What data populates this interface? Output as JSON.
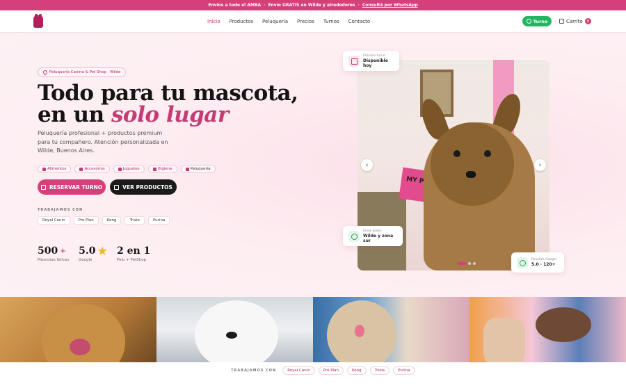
{
  "topbar": {
    "item1": "Envíos a todo el AMBA",
    "item2": "Envío GRATIS en Wilde y alrededores",
    "sep": "·",
    "link": "Consultá por WhatsApp"
  },
  "header": {
    "nav": [
      "Inicio",
      "Productos",
      "Peluquería",
      "Precios",
      "Turnos",
      "Contacto"
    ],
    "turno_label": "Turno",
    "cart_label": "Carrito",
    "cart_count": "0"
  },
  "hero": {
    "tag": "Peluquería Canina & Pet Shop · Wilde",
    "title_line1": "Todo para tu mascota,",
    "title_line2_plain": "en un ",
    "title_line2_accent": "solo lugar",
    "description": "Peluquería profesional + productos premium para tu compañero. Atención personalizada en Wilde, Buenos Aires.",
    "chips": [
      "Alimentos",
      "Accesorios",
      "Juguetes",
      "Higiene",
      "Peluquería"
    ],
    "btn_primary": "RESERVAR TURNO",
    "btn_secondary": "VER PRODUCTOS",
    "brands_label": "TRABAJAMOS CON",
    "brands": [
      "Royal Canin",
      "Pro Plan",
      "Kong",
      "Trixie",
      "Purina"
    ],
    "stats": [
      {
        "value": "500",
        "suffix": "+",
        "label": "Mascotas felices"
      },
      {
        "value": "5.0",
        "suffix": "",
        "label": "Google"
      },
      {
        "value": "2 en 1",
        "suffix": "",
        "label": "Pelu + PetShop"
      }
    ]
  },
  "photo": {
    "sign_text": "MY PETS",
    "arrow_prev": "‹",
    "arrow_next": "›"
  },
  "cards": {
    "next_small": "Próximo turno",
    "next_big": "Disponible hoy",
    "ship_small": "Envío gratis",
    "ship_big": "Wilde y zona sur",
    "reviews_small": "Reseñas Google",
    "reviews_big": "5.0 · 120+"
  },
  "bottom": {
    "label": "TRABAJAMOS CON",
    "brands": [
      "Royal Canin",
      "Pro Plan",
      "Kong",
      "Trixie",
      "Purina"
    ]
  },
  "colors": {
    "brand_pink": "#d6407a",
    "accent": "#c63b73",
    "whatsapp_green": "#23b561",
    "dark": "#1b1b1b"
  }
}
